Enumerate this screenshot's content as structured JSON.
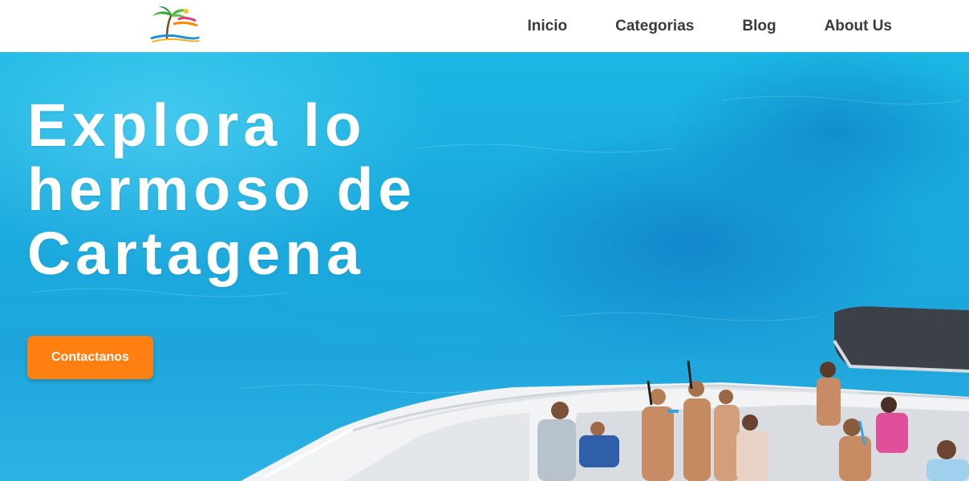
{
  "header": {
    "logo_alt": "Turismo logo",
    "nav": [
      {
        "label": "Inicio"
      },
      {
        "label": "Categorias"
      },
      {
        "label": "Blog"
      },
      {
        "label": "About Us"
      }
    ]
  },
  "hero": {
    "title": "Explora lo hermoso de Cartagena",
    "cta_label": "Contactanos"
  },
  "colors": {
    "accent": "#ff7f11",
    "sea": "#1bb7e3",
    "nav_text": "#3a3a3a"
  }
}
